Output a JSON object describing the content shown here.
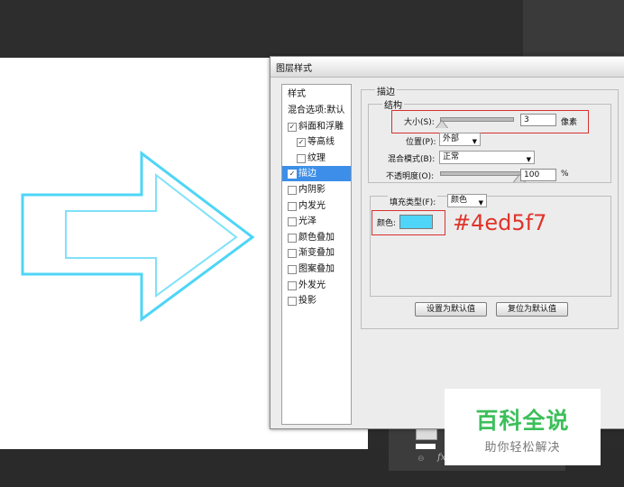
{
  "dialog": {
    "title": "图层样式",
    "sidebar": {
      "header": "样式",
      "items": [
        {
          "label": "混合选项:默认",
          "checkbox": false,
          "checked": false,
          "indent": false,
          "selected": false
        },
        {
          "label": "斜面和浮雕",
          "checkbox": true,
          "checked": true,
          "indent": false,
          "selected": false
        },
        {
          "label": "等高线",
          "checkbox": true,
          "checked": true,
          "indent": true,
          "selected": false
        },
        {
          "label": "纹理",
          "checkbox": true,
          "checked": false,
          "indent": true,
          "selected": false
        },
        {
          "label": "描边",
          "checkbox": true,
          "checked": true,
          "indent": false,
          "selected": true
        },
        {
          "label": "内阴影",
          "checkbox": true,
          "checked": false,
          "indent": false,
          "selected": false
        },
        {
          "label": "内发光",
          "checkbox": true,
          "checked": false,
          "indent": false,
          "selected": false
        },
        {
          "label": "光泽",
          "checkbox": true,
          "checked": false,
          "indent": false,
          "selected": false
        },
        {
          "label": "颜色叠加",
          "checkbox": true,
          "checked": false,
          "indent": false,
          "selected": false
        },
        {
          "label": "渐变叠加",
          "checkbox": true,
          "checked": false,
          "indent": false,
          "selected": false
        },
        {
          "label": "图案叠加",
          "checkbox": true,
          "checked": false,
          "indent": false,
          "selected": false
        },
        {
          "label": "外发光",
          "checkbox": true,
          "checked": false,
          "indent": false,
          "selected": false
        },
        {
          "label": "投影",
          "checkbox": true,
          "checked": false,
          "indent": false,
          "selected": false
        }
      ]
    },
    "stroke": {
      "section_title": "描边",
      "structure_title": "结构",
      "size_label": "大小(S):",
      "size_value": "3",
      "size_unit": "像素",
      "size_fraction": 0.02,
      "position_label": "位置(P):",
      "position_value": "外部",
      "blend_label": "混合模式(B):",
      "blend_value": "正常",
      "opacity_label": "不透明度(O):",
      "opacity_value": "100",
      "opacity_unit": "%",
      "opacity_fraction": 1.0,
      "fill_type_label": "填充类型(F):",
      "fill_type_value": "颜色",
      "color_label": "颜色:",
      "color_hex": "#4ed5f7"
    },
    "buttons": {
      "set_default": "设置为默认值",
      "reset_default": "复位为默认值"
    }
  },
  "annotation": {
    "hex": "#4ed5f7",
    "color": "#e0332a"
  },
  "watermark": {
    "title": "百科全说",
    "subtitle": "助你轻松解决"
  },
  "layers_panel": {
    "fx_label": "fx"
  },
  "colors": {
    "stroke_color": "#4ed5f7",
    "arrow_outline": "#3dbfe3",
    "selected_item": "#3d8ee8",
    "highlight_box": "#d8312f",
    "watermark_green": "#3cbf5a"
  }
}
